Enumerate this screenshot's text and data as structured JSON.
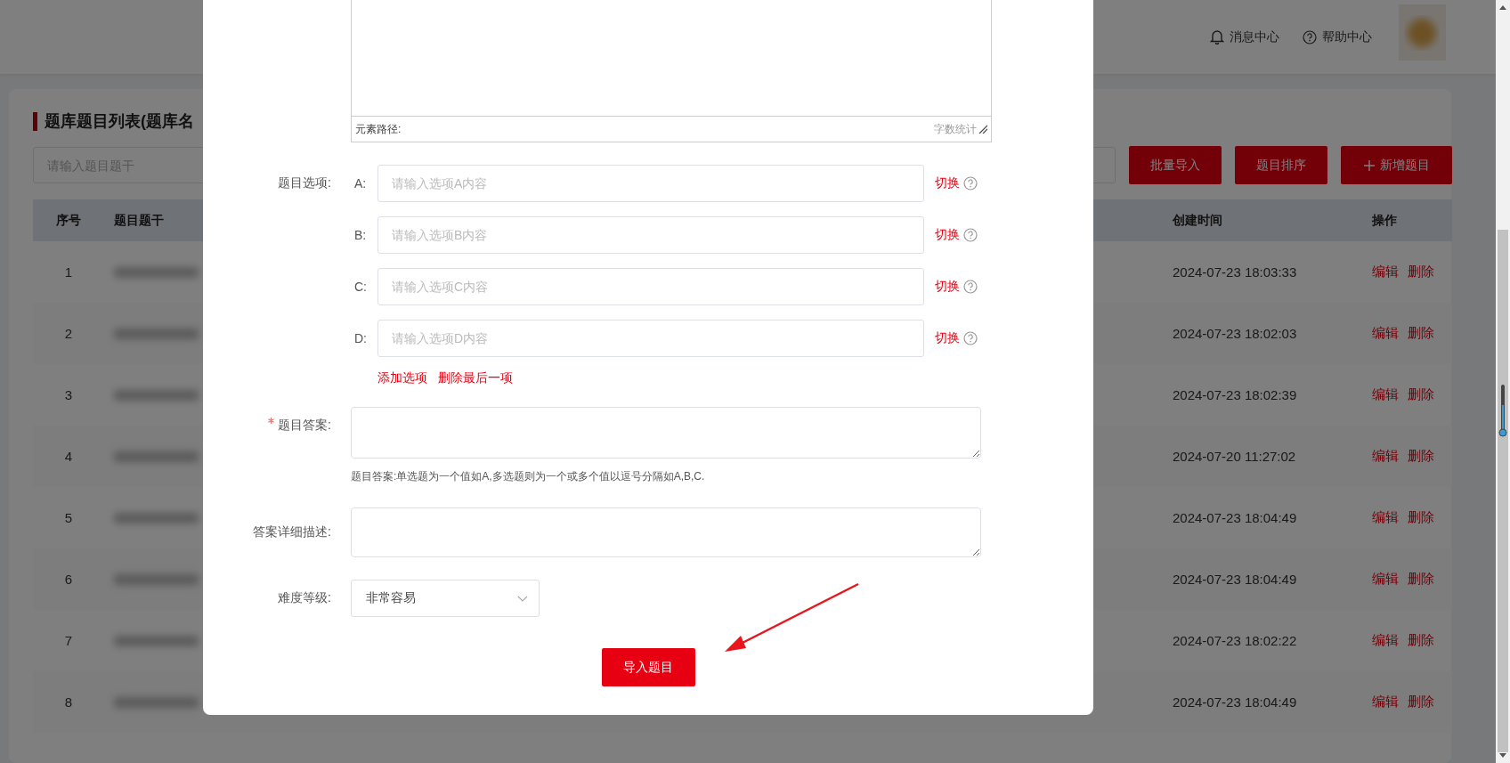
{
  "header": {
    "links": [
      {
        "kind": "bell",
        "label": "消息中心"
      },
      {
        "kind": "help",
        "label": "帮助中心"
      }
    ]
  },
  "list": {
    "title": "题库题目列表(题库名",
    "search": {
      "placeholder": "请输入题目题干"
    },
    "buttons": [
      {
        "kind": "plain",
        "label": "批量导入"
      },
      {
        "kind": "plain",
        "label": "题目排序"
      },
      {
        "kind": "add",
        "label": "新增题目"
      }
    ],
    "columns": [
      "序号",
      "题目题干",
      "创建时间",
      "操作"
    ],
    "rows": [
      {
        "index": "1",
        "created": "2024-07-23 18:03:33",
        "actions": [
          "编辑",
          "删除"
        ]
      },
      {
        "index": "2",
        "created": "2024-07-23 18:02:03",
        "actions": [
          "编辑",
          "删除"
        ]
      },
      {
        "index": "3",
        "created": "2024-07-23 18:02:39",
        "actions": [
          "编辑",
          "删除"
        ]
      },
      {
        "index": "4",
        "created": "2024-07-20 11:27:02",
        "actions": [
          "编辑",
          "删除"
        ]
      },
      {
        "index": "5",
        "created": "2024-07-23 18:04:49",
        "actions": [
          "编辑",
          "删除"
        ]
      },
      {
        "index": "6",
        "created": "2024-07-23 18:04:49",
        "actions": [
          "编辑",
          "删除"
        ]
      },
      {
        "index": "7",
        "created": "2024-07-23 18:02:22",
        "actions": [
          "编辑",
          "删除"
        ]
      },
      {
        "index": "8",
        "created": "2024-07-23 18:04:49",
        "actions": [
          "编辑",
          "删除"
        ]
      }
    ]
  },
  "modal": {
    "editor": {
      "path_label": "元素路径:",
      "word_count": "字数统计"
    },
    "options_label": "题目选项:",
    "options": [
      {
        "letter": "A:",
        "placeholder": "请输入选项A内容",
        "toggle": "切换"
      },
      {
        "letter": "B:",
        "placeholder": "请输入选项B内容",
        "toggle": "切换"
      },
      {
        "letter": "C:",
        "placeholder": "请输入选项C内容",
        "toggle": "切换"
      },
      {
        "letter": "D:",
        "placeholder": "请输入选项D内容",
        "toggle": "切换"
      }
    ],
    "option_actions": [
      "添加选项",
      "删除最后一项"
    ],
    "answer": {
      "label": "题目答案:",
      "required": true,
      "hint": "题目答案:单选题为一个值如A,多选题则为一个或多个值以逗号分隔如A,B,C."
    },
    "detail": {
      "label": "答案详细描述:"
    },
    "difficulty": {
      "label": "难度等级:",
      "value": "非常容易"
    },
    "submit": "导入题目"
  }
}
